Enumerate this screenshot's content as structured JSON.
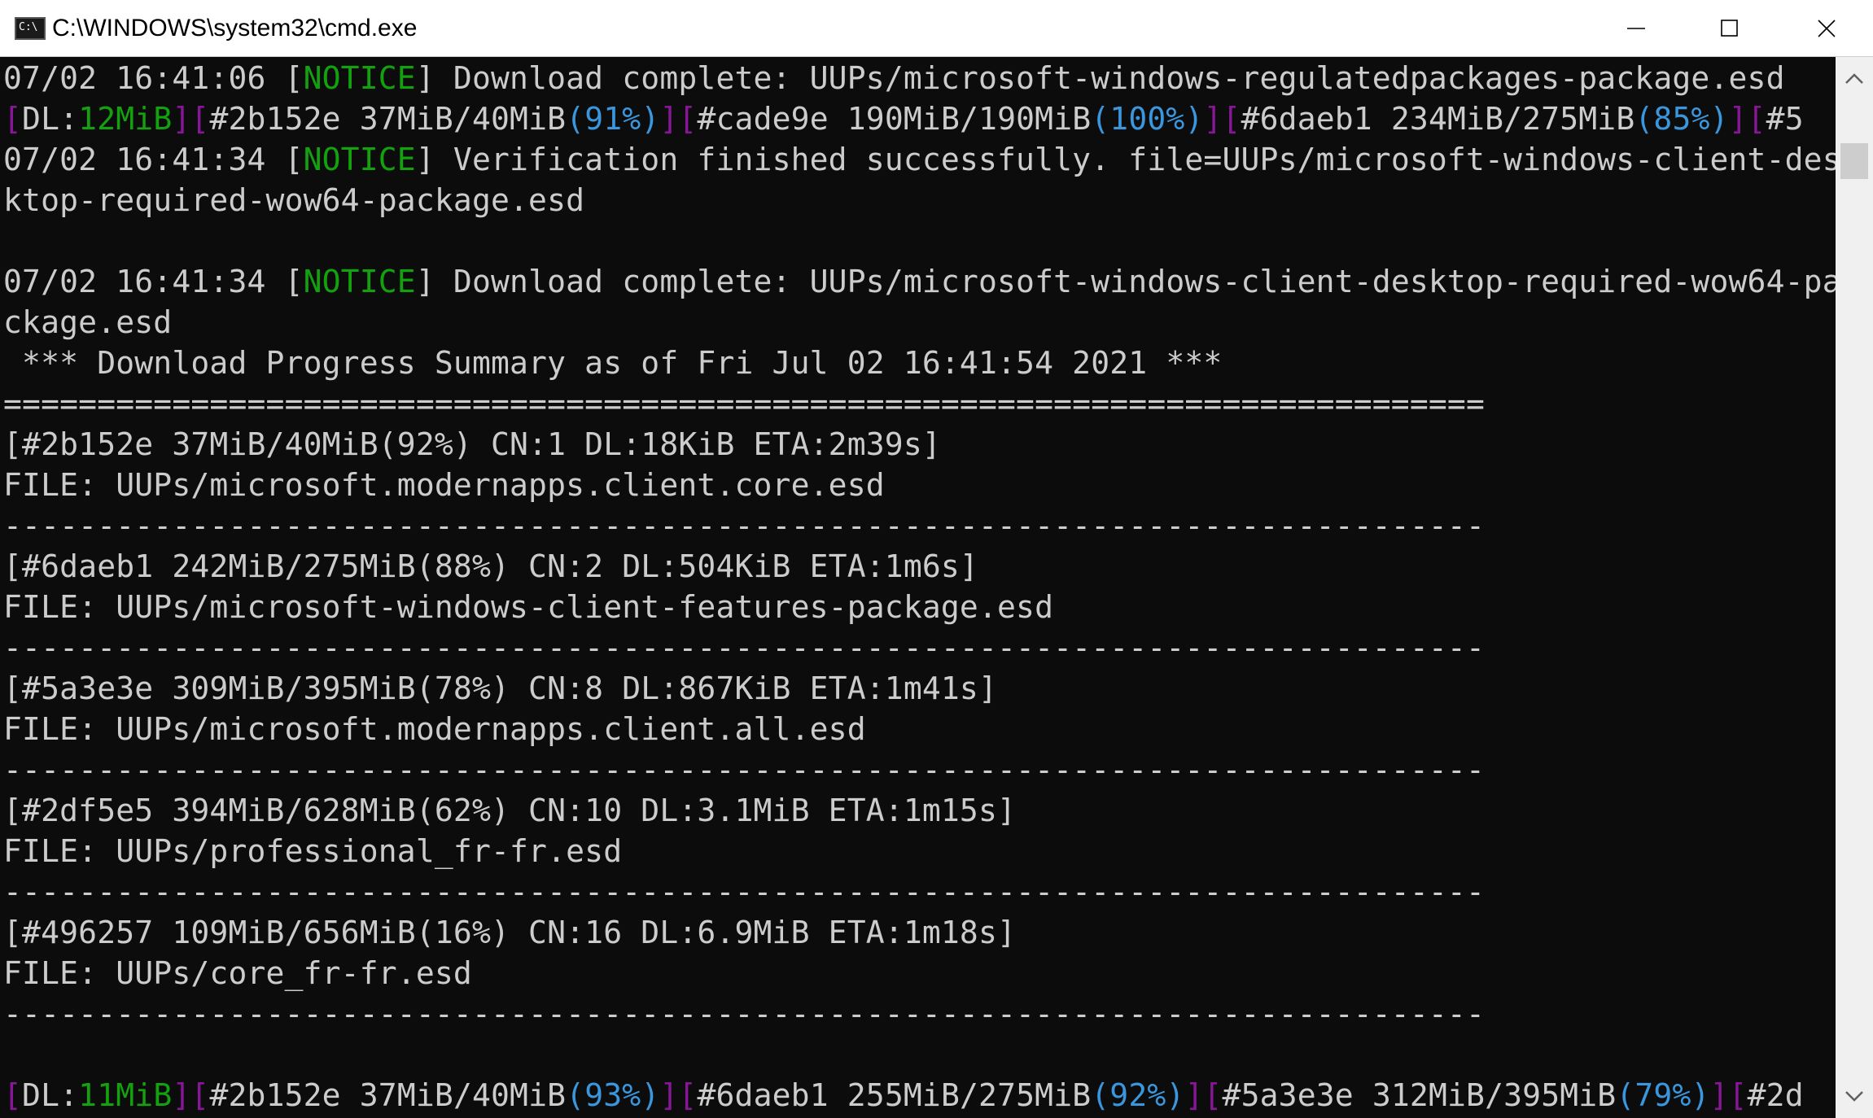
{
  "window": {
    "title": "C:\\WINDOWS\\system32\\cmd.exe",
    "icon_text": "C:\\"
  },
  "console": {
    "lines": [
      {
        "segments": [
          {
            "text": "07/02 16:41:06 [",
            "color": "default"
          },
          {
            "text": "NOTICE",
            "color": "green"
          },
          {
            "text": "] Download complete: UUPs/microsoft-windows-regulatedpackages-package.esd",
            "color": "default"
          }
        ]
      },
      {
        "segments": [
          {
            "text": "[",
            "color": "purple"
          },
          {
            "text": "DL:",
            "color": "default"
          },
          {
            "text": "12MiB",
            "color": "green"
          },
          {
            "text": "][",
            "color": "purple"
          },
          {
            "text": "#2b152e 37MiB/40MiB",
            "color": "default"
          },
          {
            "text": "(91%)",
            "color": "cyan"
          },
          {
            "text": "][",
            "color": "purple"
          },
          {
            "text": "#cade9e 190MiB/190MiB",
            "color": "default"
          },
          {
            "text": "(100%)",
            "color": "cyan"
          },
          {
            "text": "][",
            "color": "purple"
          },
          {
            "text": "#6daeb1 234MiB/275MiB",
            "color": "default"
          },
          {
            "text": "(85%)",
            "color": "cyan"
          },
          {
            "text": "][",
            "color": "purple"
          },
          {
            "text": "#5",
            "color": "default"
          }
        ]
      },
      {
        "segments": [
          {
            "text": "07/02 16:41:34 [",
            "color": "default"
          },
          {
            "text": "NOTICE",
            "color": "green"
          },
          {
            "text": "] Verification finished successfully. file=UUPs/microsoft-windows-client-des",
            "color": "default"
          }
        ]
      },
      {
        "segments": [
          {
            "text": "ktop-required-wow64-package.esd",
            "color": "default"
          }
        ]
      },
      {
        "segments": []
      },
      {
        "segments": [
          {
            "text": "07/02 16:41:34 [",
            "color": "default"
          },
          {
            "text": "NOTICE",
            "color": "green"
          },
          {
            "text": "] Download complete: UUPs/microsoft-windows-client-desktop-required-wow64-pa",
            "color": "default"
          }
        ]
      },
      {
        "segments": [
          {
            "text": "ckage.esd",
            "color": "default"
          }
        ]
      },
      {
        "segments": [
          {
            "text": " *** Download Progress Summary as of Fri Jul 02 16:41:54 2021 ***",
            "color": "default"
          }
        ]
      },
      {
        "segments": [
          {
            "text": "===============================================================================",
            "color": "default"
          }
        ]
      },
      {
        "segments": [
          {
            "text": "[#2b152e 37MiB/40MiB(92%) CN:1 DL:18KiB ETA:2m39s]",
            "color": "default"
          }
        ]
      },
      {
        "segments": [
          {
            "text": "FILE: UUPs/microsoft.modernapps.client.core.esd",
            "color": "default"
          }
        ]
      },
      {
        "segments": [
          {
            "text": "-------------------------------------------------------------------------------",
            "color": "default"
          }
        ]
      },
      {
        "segments": [
          {
            "text": "[#6daeb1 242MiB/275MiB(88%) CN:2 DL:504KiB ETA:1m6s]",
            "color": "default"
          }
        ]
      },
      {
        "segments": [
          {
            "text": "FILE: UUPs/microsoft-windows-client-features-package.esd",
            "color": "default"
          }
        ]
      },
      {
        "segments": [
          {
            "text": "-------------------------------------------------------------------------------",
            "color": "default"
          }
        ]
      },
      {
        "segments": [
          {
            "text": "[#5a3e3e 309MiB/395MiB(78%) CN:8 DL:867KiB ETA:1m41s]",
            "color": "default"
          }
        ]
      },
      {
        "segments": [
          {
            "text": "FILE: UUPs/microsoft.modernapps.client.all.esd",
            "color": "default"
          }
        ]
      },
      {
        "segments": [
          {
            "text": "-------------------------------------------------------------------------------",
            "color": "default"
          }
        ]
      },
      {
        "segments": [
          {
            "text": "[#2df5e5 394MiB/628MiB(62%) CN:10 DL:3.1MiB ETA:1m15s]",
            "color": "default"
          }
        ]
      },
      {
        "segments": [
          {
            "text": "FILE: UUPs/professional_fr-fr.esd",
            "color": "default"
          }
        ]
      },
      {
        "segments": [
          {
            "text": "-------------------------------------------------------------------------------",
            "color": "default"
          }
        ]
      },
      {
        "segments": [
          {
            "text": "[#496257 109MiB/656MiB(16%) CN:16 DL:6.9MiB ETA:1m18s]",
            "color": "default"
          }
        ]
      },
      {
        "segments": [
          {
            "text": "FILE: UUPs/core_fr-fr.esd",
            "color": "default"
          }
        ]
      },
      {
        "segments": [
          {
            "text": "-------------------------------------------------------------------------------",
            "color": "default"
          }
        ]
      },
      {
        "segments": []
      },
      {
        "segments": [
          {
            "text": "[",
            "color": "purple"
          },
          {
            "text": "DL:",
            "color": "default"
          },
          {
            "text": "11MiB",
            "color": "green"
          },
          {
            "text": "][",
            "color": "purple"
          },
          {
            "text": "#2b152e 37MiB/40MiB",
            "color": "default"
          },
          {
            "text": "(93%)",
            "color": "cyan"
          },
          {
            "text": "][",
            "color": "purple"
          },
          {
            "text": "#6daeb1 255MiB/275MiB",
            "color": "default"
          },
          {
            "text": "(92%)",
            "color": "cyan"
          },
          {
            "text": "][",
            "color": "purple"
          },
          {
            "text": "#5a3e3e 312MiB/395MiB",
            "color": "default"
          },
          {
            "text": "(79%)",
            "color": "cyan"
          },
          {
            "text": "][",
            "color": "purple"
          },
          {
            "text": "#2d",
            "color": "default"
          }
        ]
      }
    ]
  },
  "colors": {
    "background": "#0c0c0c",
    "default": "#cccccc",
    "green": "#13a10e",
    "purple": "#881798",
    "cyan": "#3a96dd"
  },
  "scrollbar": {
    "up_icon": "scroll-up-arrow-icon",
    "down_icon": "scroll-down-arrow-icon"
  }
}
